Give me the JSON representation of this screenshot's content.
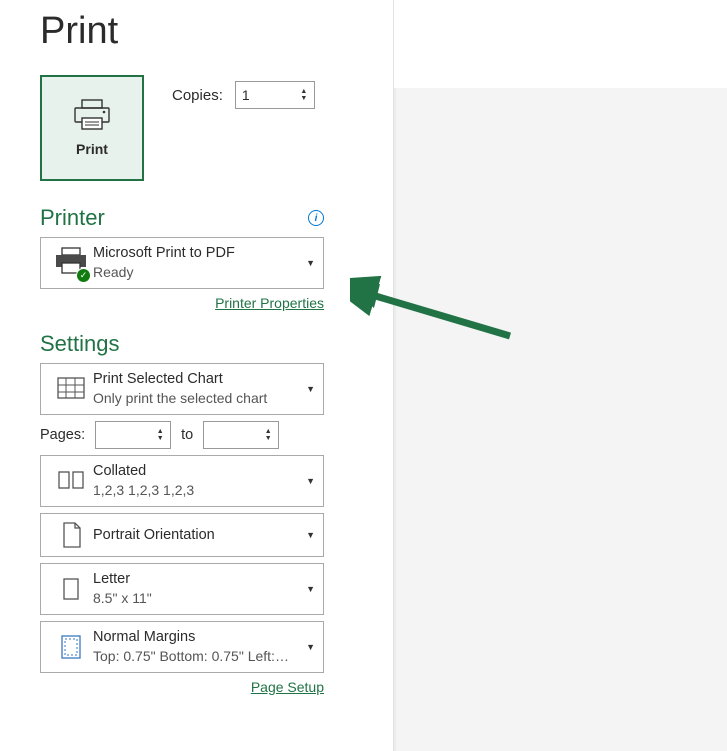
{
  "title": "Print",
  "print_button": {
    "label": "Print"
  },
  "copies": {
    "label": "Copies:",
    "value": "1"
  },
  "printer_section": {
    "heading": "Printer",
    "selected": {
      "name": "Microsoft Print to PDF",
      "status": "Ready"
    },
    "properties_link": "Printer Properties"
  },
  "settings_section": {
    "heading": "Settings",
    "scope": {
      "primary": "Print Selected Chart",
      "secondary": "Only print the selected chart"
    },
    "pages": {
      "label": "Pages:",
      "from": "",
      "to_label": "to",
      "to": ""
    },
    "collation": {
      "primary": "Collated",
      "secondary": "1,2,3    1,2,3    1,2,3"
    },
    "orientation": {
      "primary": "Portrait Orientation"
    },
    "paper": {
      "primary": "Letter",
      "secondary": "8.5\" x 11\""
    },
    "margins": {
      "primary": "Normal Margins",
      "secondary": "Top: 0.75\" Bottom: 0.75\" Left:…"
    },
    "page_setup_link": "Page Setup"
  }
}
